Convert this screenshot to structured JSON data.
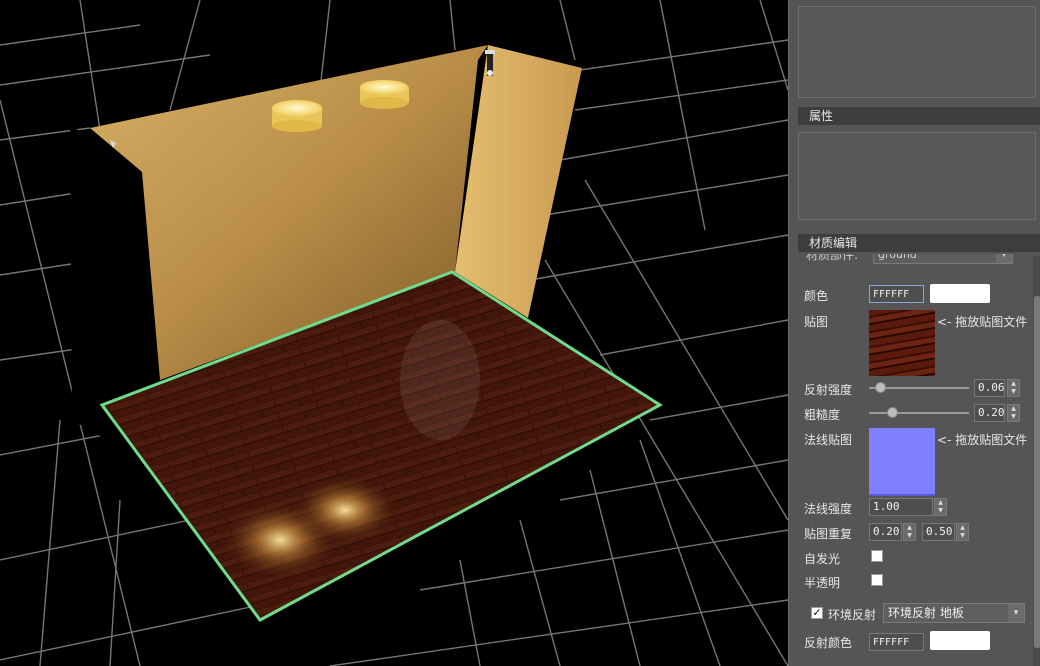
{
  "colors": {
    "panel_bg": "#555555",
    "header_bg": "#3d3d3d",
    "selection_outline": "#6fdc8c",
    "grid_line": "#8a8a8a",
    "wall": "#c9a055",
    "floor_wood": "#3a120a",
    "normal_map": "#8080ff"
  },
  "scene": {
    "objects": [
      "grid",
      "back-wall",
      "right-wall",
      "floor-ground",
      "ceiling-light",
      "ceiling-light",
      "spot-light",
      "spot-light"
    ]
  },
  "panel": {
    "properties_header": "属性",
    "material_header": "材质编辑",
    "material_name_label": "材质部件:",
    "material_name_value": "ground",
    "color": {
      "label": "颜色",
      "hex": "FFFFFF",
      "swatch": "#ffffff"
    },
    "texture": {
      "label": "贴图",
      "hint": "<- 拖放贴图文件"
    },
    "reflection_strength": {
      "label": "反射强度",
      "value": "0.06",
      "fraction": 0.06
    },
    "roughness": {
      "label": "粗糙度",
      "value": "0.20",
      "fraction": 0.2
    },
    "normal_map": {
      "label": "法线贴图",
      "hint": "<- 拖放贴图文件"
    },
    "normal_strength": {
      "label": "法线强度",
      "value": "1.00"
    },
    "texture_repeat": {
      "label": "贴图重复",
      "u": "0.20",
      "v": "0.50"
    },
    "emissive": {
      "label": "自发光",
      "checked": false
    },
    "translucent": {
      "label": "半透明",
      "checked": false
    },
    "env_reflection": {
      "label": "环境反射",
      "checked": true,
      "selected": "环境反射 地板"
    },
    "reflection_color": {
      "label": "反射颜色",
      "hex": "FFFFFF",
      "swatch": "#ffffff"
    }
  }
}
